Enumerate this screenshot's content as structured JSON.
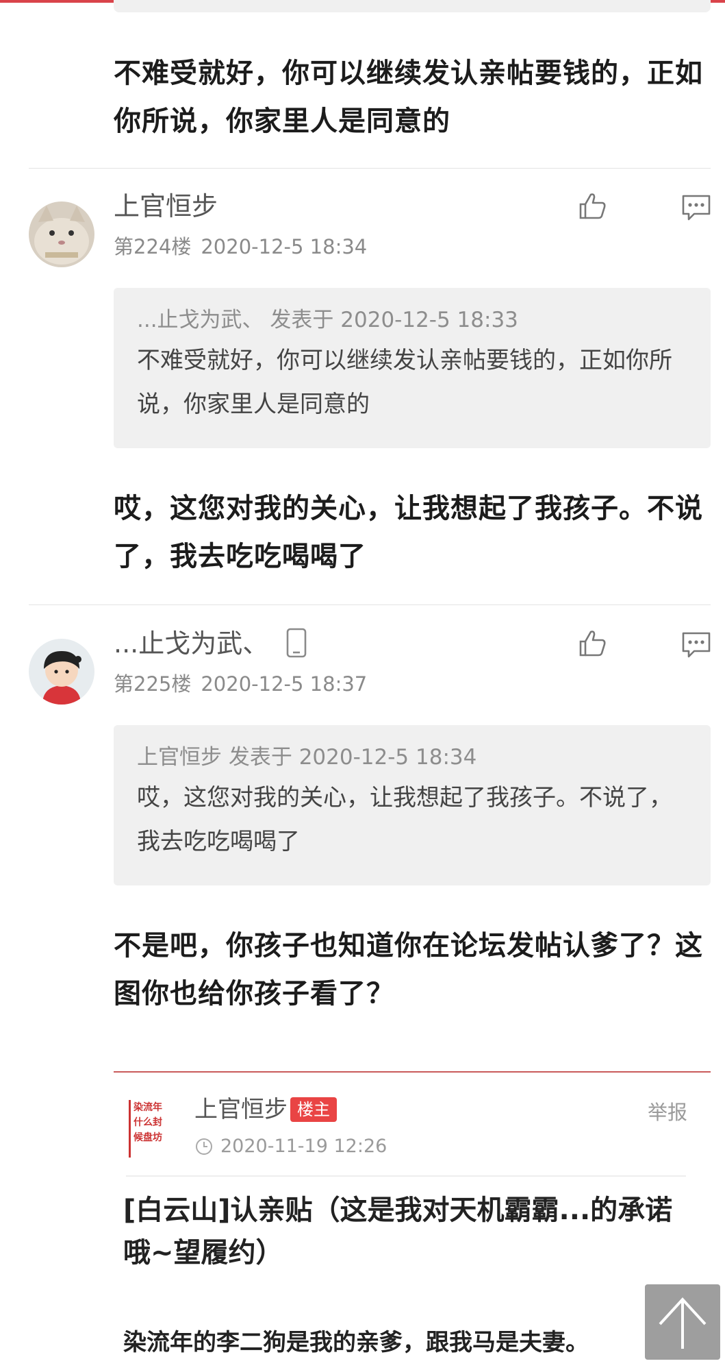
{
  "top_post": {
    "text": "不难受就好，你可以继续发认亲帖要钱的，正如你所说，你家里人是同意的"
  },
  "posts": [
    {
      "username": "上官恒步",
      "floor": "第224楼",
      "time": "2020-12-5 18:34",
      "quote_header": "...止戈为武、 发表于 2020-12-5 18:33",
      "quote_text": "不难受就好，你可以继续发认亲帖要钱的，正如你所说，你家里人是同意的",
      "text": "哎，这您对我的关心，让我想起了我孩子。不说了，我去吃吃喝喝了"
    },
    {
      "username": "...止戈为武、",
      "floor": "第225楼",
      "time": "2020-12-5 18:37",
      "quote_header": "上官恒步 发表于 2020-12-5 18:34",
      "quote_text": "哎，这您对我的关心，让我想起了我孩子。不说了，我去吃吃喝喝了",
      "text": "不是吧，你孩子也知道你在论坛发帖认爹了？这图你也给你孩子看了？"
    }
  ],
  "embed": {
    "logo_lines": [
      "染流年",
      "什么封",
      "候盘坊"
    ],
    "username": "上官恒步",
    "badge": "楼主",
    "time": "2020-11-19 12:26",
    "report": "举报",
    "title": "[白云山]认亲贴（这是我对天机霸霸...的承诺哦~望履约）",
    "body": "染流年的李二狗是我的亲爹，跟我马是夫妻。"
  },
  "colors": {
    "accent": "#d9434a",
    "badge": "#e94444",
    "quote_bg": "#f0f0f0",
    "meta": "#8a8a8a"
  },
  "icons": {
    "like": "thumbs-up-icon",
    "reply": "comment-icon",
    "device": "phone-icon",
    "back_to_top": "arrow-up-icon"
  }
}
